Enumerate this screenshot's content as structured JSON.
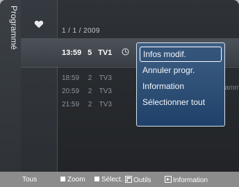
{
  "sidebar": {
    "label": "Programmé"
  },
  "main": {
    "date": "1 / 1 / 2009",
    "selected": {
      "time": "13:59",
      "channel": "5",
      "station": "TV1"
    },
    "rows": [
      {
        "time": "18:59",
        "channel": "2",
        "station": "TV3"
      },
      {
        "time": "20:59",
        "channel": "2",
        "station": "TV3"
      },
      {
        "time": "21:59",
        "channel": "2",
        "station": "TV3"
      }
    ],
    "program_title": "M.Spillane's Mike Hammer"
  },
  "popup": {
    "items": [
      {
        "label": "Infos modif."
      },
      {
        "label": "Annuler progr."
      },
      {
        "label": "Information"
      },
      {
        "label": "Sélectionner tout"
      }
    ]
  },
  "footer": {
    "all": "Tous",
    "zoom": "Zoom",
    "select": "Sélect.",
    "tools": "Outils",
    "information": "Information"
  },
  "icons": {
    "favorite": "heart-icon",
    "timer": "clock-icon",
    "tools": "tools-icon",
    "info": "info-icon"
  },
  "colors": {
    "panel": "#2b2f34",
    "popup": "#2e5078",
    "highlight": "#4a5057",
    "footer": "#8c8c8c"
  }
}
